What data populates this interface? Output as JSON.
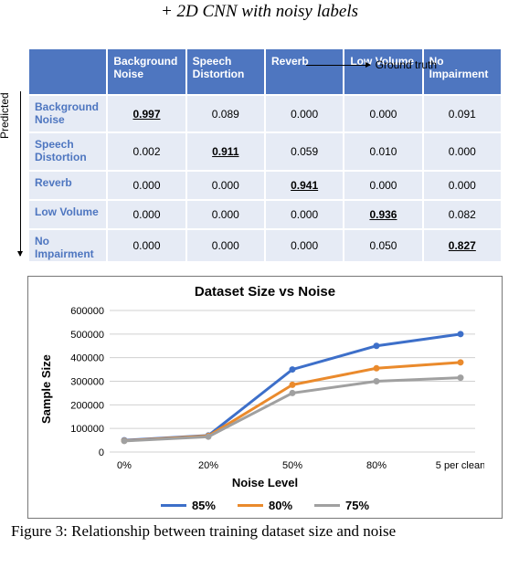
{
  "title_line": "+ 2D CNN with noisy labels",
  "axes": {
    "predicted": "Predicted",
    "ground_truth": "Ground truth"
  },
  "confusion": {
    "columns": [
      "Background Noise",
      "Speech Distortion",
      "Reverb",
      "Low Volume",
      "No Impairment"
    ],
    "rows": [
      {
        "label": "Background Noise",
        "vals": [
          "0.997",
          "0.089",
          "0.000",
          "0.000",
          "0.091"
        ]
      },
      {
        "label": "Speech Distortion",
        "vals": [
          "0.002",
          "0.911",
          "0.059",
          "0.010",
          "0.000"
        ]
      },
      {
        "label": "Reverb",
        "vals": [
          "0.000",
          "0.000",
          "0.941",
          "0.000",
          "0.000"
        ]
      },
      {
        "label": "Low Volume",
        "vals": [
          "0.000",
          "0.000",
          "0.000",
          "0.936",
          "0.082"
        ]
      },
      {
        "label": "No Impairment",
        "vals": [
          "0.000",
          "0.000",
          "0.000",
          "0.050",
          "0.827"
        ]
      }
    ]
  },
  "chart_data": {
    "type": "line",
    "title": "Dataset Size vs Noise",
    "xlabel": "Noise Level",
    "ylabel": "Sample Size",
    "categories": [
      "0%",
      "20%",
      "50%",
      "80%",
      "5 per clean"
    ],
    "yticks": [
      0,
      100000,
      200000,
      300000,
      400000,
      500000,
      600000
    ],
    "ylim": [
      0,
      600000
    ],
    "series": [
      {
        "name": "85%",
        "color": "#3d6fc9",
        "values": [
          50000,
          70000,
          350000,
          450000,
          500000
        ]
      },
      {
        "name": "80%",
        "color": "#ea8a2c",
        "values": [
          48000,
          68000,
          285000,
          355000,
          380000
        ]
      },
      {
        "name": "75%",
        "color": "#a0a0a0",
        "values": [
          47000,
          65000,
          250000,
          300000,
          315000
        ]
      }
    ]
  },
  "caption": "Figure 3: Relationship between training dataset size and noise"
}
